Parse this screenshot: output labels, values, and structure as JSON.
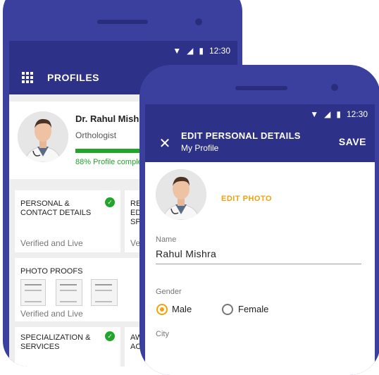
{
  "status_bar": {
    "time": "12:30",
    "wifi_icon": "wifi-icon",
    "signal_icon": "signal-icon",
    "battery_icon": "battery-icon"
  },
  "back_screen": {
    "title": "PROFILES",
    "menu_icon": "grid-menu-icon",
    "profile": {
      "name": "Dr. Rahul Mishra",
      "role": "Orthologist",
      "progress_percent": 88,
      "progress_text": "88% Profile complete",
      "progress_color": "#21a52a"
    },
    "tiles": [
      {
        "title": "PERSONAL & CONTACT DETAILS",
        "status": "Verified and Live",
        "verified": true
      },
      {
        "title": "RE ED SP",
        "status": "Ve",
        "verified": false
      },
      {
        "title": "PHOTO PROOFS",
        "status": "Verified and Live",
        "verified": false
      },
      {
        "title": "SPECIALIZATION & SERVICES",
        "status": "",
        "verified": true
      },
      {
        "title": "AW AC",
        "status": "",
        "verified": false
      }
    ]
  },
  "front_screen": {
    "title": "EDIT PERSONAL DETAILS",
    "subtitle": "My Profile",
    "save_label": "SAVE",
    "close_icon": "close-icon",
    "edit_photo_label": "EDIT PHOTO",
    "name_label": "Name",
    "name_value": "Rahul Mishra",
    "gender_label": "Gender",
    "gender_options": [
      "Male",
      "Female"
    ],
    "gender_selected": "Male",
    "city_label": "City"
  },
  "colors": {
    "primary": "#2d3187",
    "frame": "#3b3f9d",
    "accent": "#f2a20c",
    "success": "#21a52a"
  }
}
